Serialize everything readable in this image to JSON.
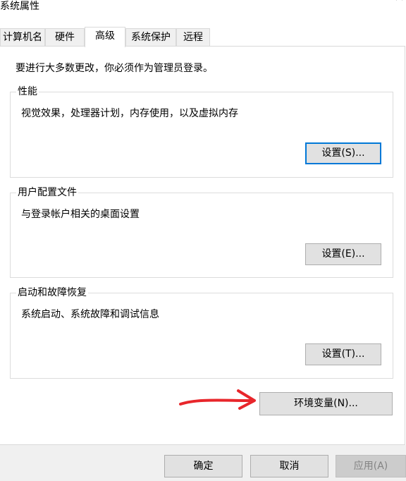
{
  "window": {
    "title": "系统属性",
    "close_glyph": "×"
  },
  "tabs": [
    {
      "label": "计算机名",
      "active": false
    },
    {
      "label": "硬件",
      "active": false
    },
    {
      "label": "高级",
      "active": true
    },
    {
      "label": "系统保护",
      "active": false
    },
    {
      "label": "远程",
      "active": false
    }
  ],
  "advanced": {
    "admin_notice": "要进行大多数更改，你必须作为管理员登录。",
    "performance": {
      "title": "性能",
      "description": "视觉效果，处理器计划，内存使用，以及虚拟内存",
      "button": "设置(S)..."
    },
    "user_profiles": {
      "title": "用户配置文件",
      "description": "与登录帐户相关的桌面设置",
      "button": "设置(E)..."
    },
    "startup_recovery": {
      "title": "启动和故障恢复",
      "description": "系统启动、系统故障和调试信息",
      "button": "设置(T)..."
    },
    "env_button": "环境变量(N)..."
  },
  "footer": {
    "ok": "确定",
    "cancel": "取消",
    "apply": "应用(A)"
  },
  "annotation": {
    "icon": "red-arrow-icon",
    "color": "#e8262b"
  },
  "colors": {
    "focus_border": "#0078d7",
    "button_face": "#e1e1e1",
    "footer_bg": "#f0f0f0"
  }
}
